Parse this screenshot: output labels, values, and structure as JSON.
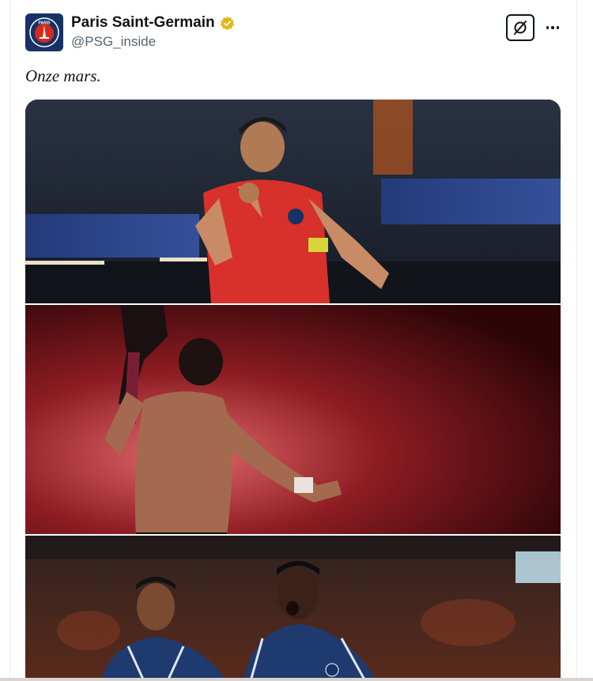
{
  "author": {
    "name": "Paris Saint-Germain",
    "handle": "@PSG_inside",
    "avatar_text": "PARIS",
    "verified": true,
    "verified_color": "#e2b719"
  },
  "post": {
    "text": "Onze mars."
  },
  "actions": {
    "grok_icon": "grok-icon",
    "more_icon": "more-icon"
  },
  "media": {
    "photos": [
      {
        "subject": "player-celebrating-red-kit"
      },
      {
        "subject": "shirtless-player-red-smoke"
      },
      {
        "subject": "two-players-navy-kit"
      }
    ]
  },
  "colors": {
    "text_primary": "#0f1419",
    "text_secondary": "#536471",
    "psg_navy": "#173264",
    "psg_red": "#da291c"
  }
}
